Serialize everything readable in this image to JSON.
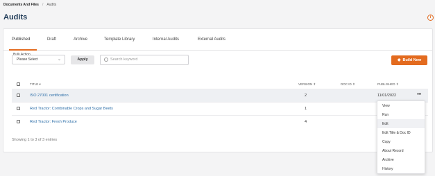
{
  "breadcrumb": {
    "root": "Documents And Files",
    "separator": "/",
    "current": "Audits"
  },
  "page": {
    "title": "Audits",
    "info_icon": "info-icon"
  },
  "tabs": [
    {
      "label": "Published",
      "active": true
    },
    {
      "label": "Draft",
      "active": false
    },
    {
      "label": "Archive",
      "active": false
    },
    {
      "label": "Template Library",
      "active": false
    },
    {
      "label": "Internal Audits",
      "active": false
    },
    {
      "label": "External Audits",
      "active": false
    }
  ],
  "filters": {
    "bulk_label": "Bulk Action",
    "bulk_value": "Please Select",
    "apply_label": "Apply",
    "search_placeholder": "Search keyword",
    "build_label": "Build New"
  },
  "table": {
    "columns": [
      "TITLE",
      "VERSION",
      "DOC ID",
      "PUBLISHED"
    ],
    "rows": [
      {
        "title": "ISO 27001 certification",
        "version": "2",
        "doc_id": "",
        "published": "11/01/2022"
      },
      {
        "title": "Red Tractor: Combinable Crops and Sugar Beets",
        "version": "1",
        "doc_id": "",
        "published": ""
      },
      {
        "title": "Red Tractor: Fresh Produce",
        "version": "4",
        "doc_id": "",
        "published": ""
      }
    ],
    "entries_text": "Showing 1 to 3 of 3 entries"
  },
  "row_menu": [
    "View",
    "Run",
    "Edit",
    "Edit Title & Doc ID",
    "Copy",
    "About Record",
    "Archive",
    "History"
  ],
  "colors": {
    "accent": "#e36b1f",
    "link": "#2c6ea8",
    "title": "#1f3a57"
  }
}
